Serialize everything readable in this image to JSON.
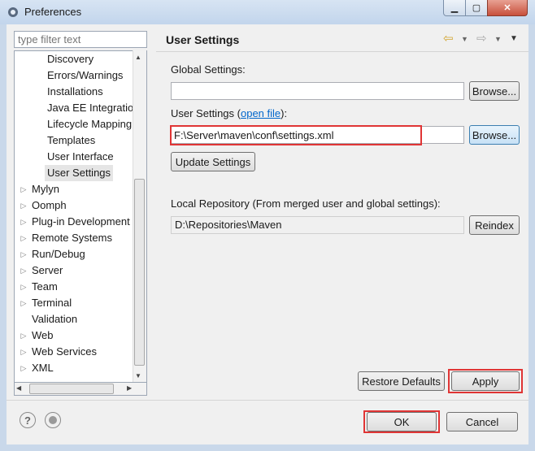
{
  "window": {
    "title": "Preferences"
  },
  "filter": {
    "placeholder": "type filter text"
  },
  "tree": {
    "children": [
      "Discovery",
      "Errors/Warnings",
      "Installations",
      "Java EE Integration",
      "Lifecycle Mapping",
      "Templates",
      "User Interface",
      "User Settings"
    ],
    "items": [
      {
        "label": "Mylyn",
        "expandable": true
      },
      {
        "label": "Oomph",
        "expandable": true
      },
      {
        "label": "Plug-in Development",
        "expandable": true
      },
      {
        "label": "Remote Systems",
        "expandable": true
      },
      {
        "label": "Run/Debug",
        "expandable": true
      },
      {
        "label": "Server",
        "expandable": true
      },
      {
        "label": "Team",
        "expandable": true
      },
      {
        "label": "Terminal",
        "expandable": true
      },
      {
        "label": "Validation",
        "expandable": false
      },
      {
        "label": "Web",
        "expandable": true
      },
      {
        "label": "Web Services",
        "expandable": true
      },
      {
        "label": "XML",
        "expandable": true
      }
    ],
    "selected": "User Settings"
  },
  "page": {
    "title": "User Settings",
    "global_settings_label": "Global Settings:",
    "global_settings_value": "",
    "browse_label": "Browse...",
    "user_settings_label": "User Settings (",
    "open_file_link": "open file",
    "user_settings_label_end": "):",
    "user_settings_value": "F:\\Server\\maven\\conf\\settings.xml",
    "update_settings_label": "Update Settings",
    "local_repo_label": "Local Repository (From merged user and global settings):",
    "local_repo_value": "D:\\Repositories\\Maven",
    "reindex_label": "Reindex",
    "restore_defaults_label": "Restore Defaults",
    "apply_label": "Apply"
  },
  "footer": {
    "ok_label": "OK",
    "cancel_label": "Cancel"
  },
  "icons": [
    "gear-icon",
    "help-icon",
    "record-icon",
    "back-arrow-icon",
    "forward-arrow-icon",
    "chevron-down-icon",
    "minimize-icon",
    "maximize-icon",
    "close-icon"
  ],
  "colors": {
    "highlight": "#e03535",
    "link": "#0066cc",
    "titlebar": "#c9d8ea"
  }
}
